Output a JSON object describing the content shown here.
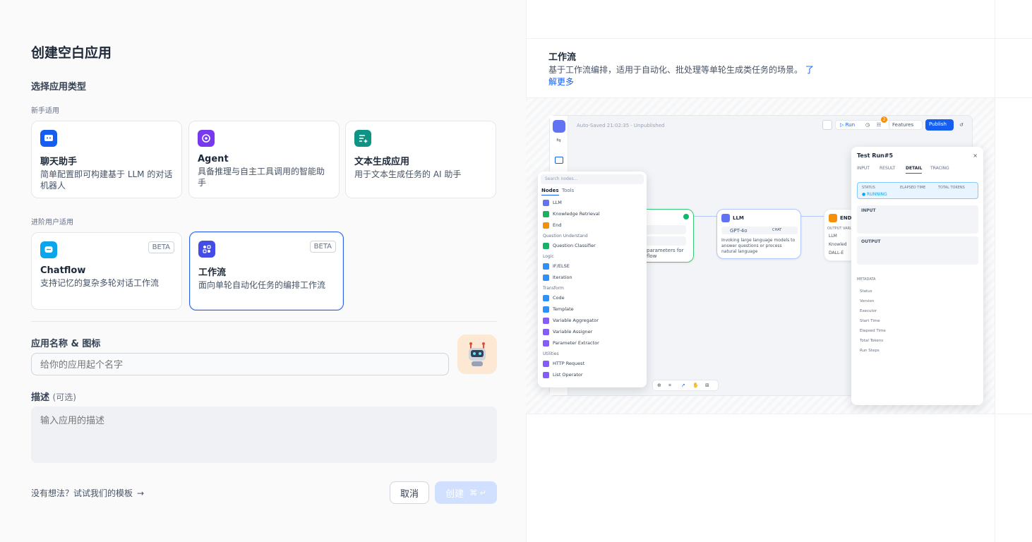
{
  "form": {
    "title": "创建空白应用",
    "section_type": "选择应用类型",
    "group_beginner": "新手适用",
    "group_advanced": "进阶用户适用",
    "cards": [
      {
        "title": "聊天助手",
        "desc": "简单配置即可构建基于 LLM 的对话机器人",
        "icon": "chat-bubble-icon",
        "color": "#155eef"
      },
      {
        "title": "Agent",
        "desc": "具备推理与自主工具调用的智能助手",
        "icon": "agent-icon",
        "color": "#7839ee"
      },
      {
        "title": "文本生成应用",
        "desc": "用于文本生成任务的 AI 助手",
        "icon": "text-generate-icon",
        "color": "#0e9384"
      },
      {
        "title": "Chatflow",
        "desc": "支持记忆的复杂多轮对话工作流",
        "icon": "chatflow-icon",
        "color": "#0ba5ec",
        "badge": "BETA"
      },
      {
        "title": "工作流",
        "desc": "面向单轮自动化任务的编排工作流",
        "icon": "workflow-icon",
        "color": "#444ce7",
        "badge": "BETA",
        "selected": true
      }
    ],
    "name_label": "应用名称 & 图标",
    "name_placeholder": "给你的应用起个名字",
    "desc_label": "描述",
    "desc_optional": "(可选)",
    "desc_placeholder": "输入应用的描述",
    "template_link": "没有想法？试试我们的模板",
    "cancel_label": "取消",
    "create_label": "创建",
    "create_shortcut": "⌘ ↵"
  },
  "preview": {
    "title": "工作流",
    "desc": "基于工作流编排，适用于自动化、批处理等单轮生成类任务的场景。",
    "learn_more": "了解更多",
    "topbar": {
      "saved": "Auto-Saved 21:02:35 · Unpublished",
      "run": "Run",
      "features": "Features",
      "publish": "Publish",
      "badge": "2"
    },
    "search_placeholder": "Search nodes...",
    "tabs": [
      "Nodes",
      "Tools"
    ],
    "node_groups": [
      {
        "label": "",
        "items": [
          "LLM",
          "Knowledge Retrieval",
          "End"
        ]
      },
      {
        "label": "Question Understand",
        "items": [
          "Question Classifier"
        ]
      },
      {
        "label": "Logic",
        "items": [
          "IF/ELSE",
          "Iteration"
        ]
      },
      {
        "label": "Transform",
        "items": [
          "Code",
          "Template",
          "Variable Aggregator",
          "Variable Assigner",
          "Parameter Extractor"
        ]
      },
      {
        "label": "Utilities",
        "items": [
          "HTTP Request",
          "List Operator"
        ]
      }
    ],
    "llm_node": {
      "title": "LLM",
      "model": "GPT-4o",
      "mode": "CHAT",
      "desc": "Invoking large language models to answer questions or process natural language"
    },
    "start_node_desc": "parameters for flow",
    "end_node": {
      "title": "END",
      "label": "OUTPUT VARIA",
      "items": [
        "LLM",
        "Knowled",
        "DALL-E"
      ]
    },
    "test_run": {
      "title": "Test Run#5",
      "tabs": [
        "INPUT",
        "RESULT",
        "DETAIL",
        "TRACING"
      ],
      "status_headers": [
        "STATUS",
        "ELAPSED TIME",
        "TOTAL TOKENS"
      ],
      "status": "RUNNING",
      "input_label": "INPUT",
      "output_label": "OUTPUT",
      "metadata_label": "METADATA",
      "metadata": [
        "Status",
        "Version",
        "Executor",
        "Start Time",
        "Elapsed Time",
        "Total Tokens",
        "Run Steps"
      ]
    }
  }
}
